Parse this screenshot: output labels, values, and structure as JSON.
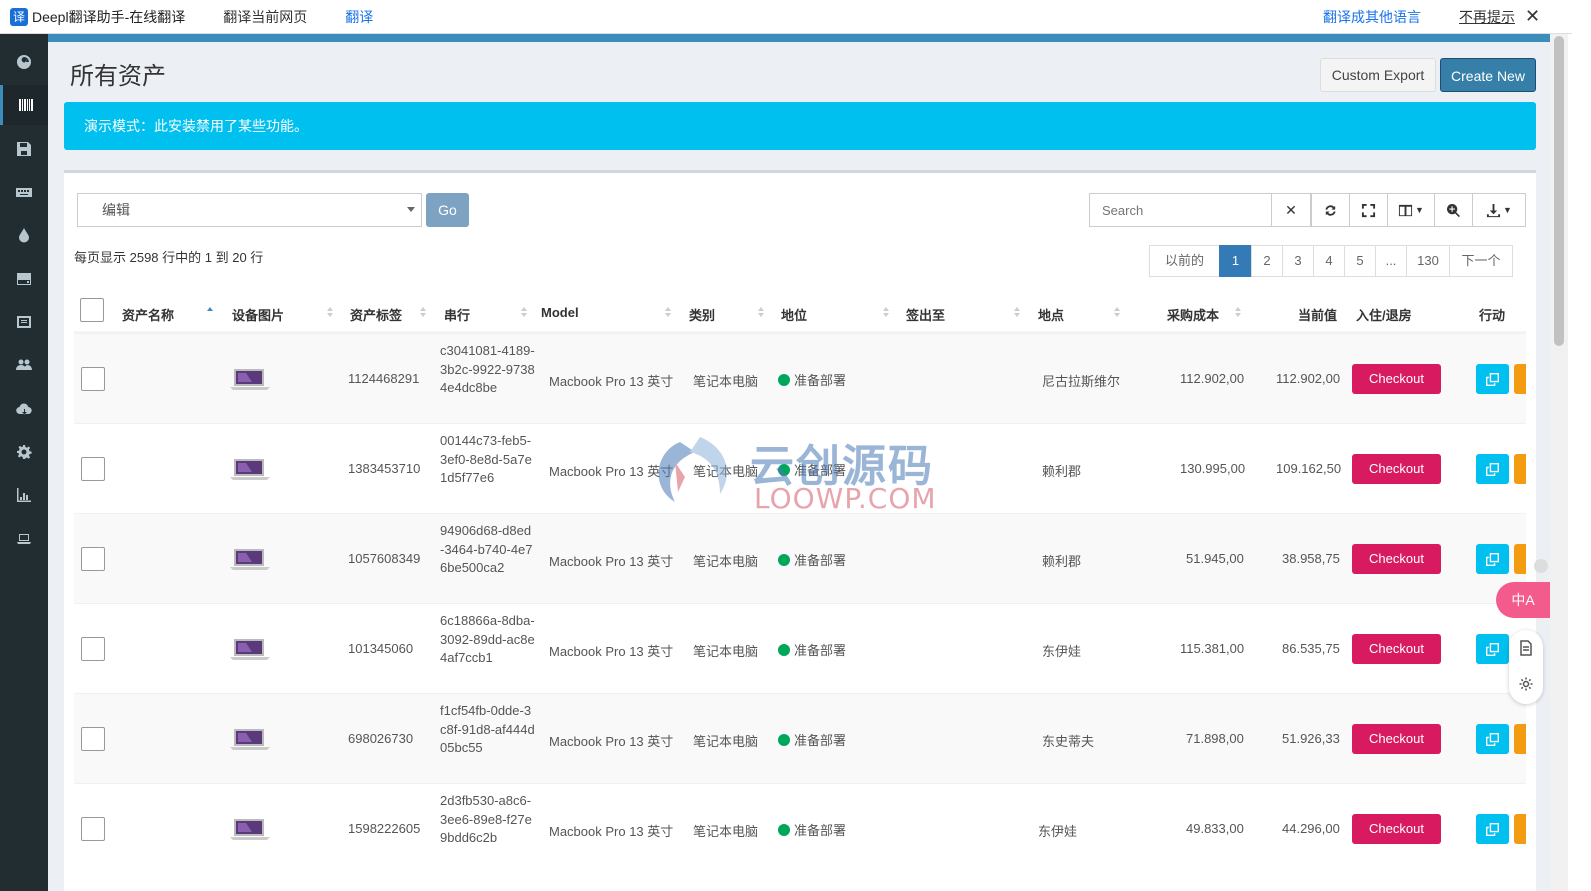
{
  "translate_bar": {
    "logo_char": "译",
    "title": "Deepl翻译助手-在线翻译",
    "translate_page": "翻译当前网页",
    "translate": "翻译",
    "other_lang": "翻译成其他语言",
    "dont_show": "不再提示",
    "close": "✕"
  },
  "page": {
    "title": "所有资产",
    "custom_export": "Custom Export",
    "create_new": "Create New",
    "demo_alert": "演示模式：此安装禁用了某些功能。"
  },
  "toolbar": {
    "bulk_action": "编辑",
    "go": "Go",
    "search_placeholder": "Search",
    "clear": "✕"
  },
  "pagination": {
    "info": "每页显示 2598 行中的 1 到 20 行",
    "prev": "以前的",
    "pages": [
      "1",
      "2",
      "3",
      "4",
      "5",
      "...",
      "130"
    ],
    "next": "下一个",
    "active_page": "1"
  },
  "table": {
    "headers": {
      "name": "资产名称",
      "image": "设备图片",
      "tag": "资产标签",
      "serial": "串行",
      "model": "Model",
      "category": "类别",
      "status": "地位",
      "checked_out_to": "签出至",
      "location": "地点",
      "purchase_cost": "采购成本",
      "current_value": "当前值",
      "checkin_out": "入住/退房",
      "actions": "行动"
    },
    "checkout_label": "Checkout",
    "rows": [
      {
        "tag": "1124468291",
        "serial": "c3041081-4189-3b2c-9922-97384e4dc8be",
        "model": "Macbook Pro 13 英寸",
        "category": "笔记本电脑",
        "status": "准备部署",
        "location": "尼古拉斯维尔",
        "cost": "112.902,00",
        "value": "112.902,00"
      },
      {
        "tag": "1383453710",
        "serial": "00144c73-feb5-3ef0-8e8d-5a7e1d5f77e6",
        "model": "Macbook Pro 13 英寸",
        "category": "笔记本电脑",
        "status": "准备部署",
        "location": "赖利郡",
        "cost": "130.995,00",
        "value": "109.162,50"
      },
      {
        "tag": "1057608349",
        "serial": "94906d68-d8ed-3464-b740-4e76be500ca2",
        "model": "Macbook Pro 13 英寸",
        "category": "笔记本电脑",
        "status": "准备部署",
        "location": "赖利郡",
        "cost": "51.945,00",
        "value": "38.958,75"
      },
      {
        "tag": "101345060",
        "serial": "6c18866a-8dba-3092-89dd-ac8e4af7ccb1",
        "model": "Macbook Pro 13 英寸",
        "category": "笔记本电脑",
        "status": "准备部署",
        "location": "东伊娃",
        "cost": "115.381,00",
        "value": "86.535,75"
      },
      {
        "tag": "698026730",
        "serial": "f1cf54fb-0dde-3c8f-91d8-af444d05bc55",
        "model": "Macbook Pro 13 英寸",
        "category": "笔记本电脑",
        "status": "准备部署",
        "location": "东史蒂夫",
        "cost": "71.898,00",
        "value": "51.926,33"
      },
      {
        "tag": "1598222605",
        "serial": "2d3fb530-a8c6-3ee6-89e8-f27e9bdd6c2b",
        "model": "Macbook Pro 13 英寸",
        "category": "笔记本电脑",
        "status": "准备部署",
        "location": "东伊娃",
        "cost": "49.833,00",
        "value": "44.296,00"
      }
    ]
  },
  "watermark": {
    "cn": "云创源码",
    "en": "LOOWP.COM"
  },
  "float_widget": {
    "label": "中A"
  },
  "colors": {
    "sidebar": "#222d32",
    "primary": "#3c8dbc",
    "info": "#00c0ef",
    "checkout": "#d81b60",
    "status_ready": "#00a65a",
    "edit": "#f39c12"
  },
  "icons": {
    "sidebar": [
      "dashboard-icon",
      "barcode-icon",
      "save-icon",
      "keyboard-icon",
      "tint-icon",
      "hdd-icon",
      "license-icon",
      "users-icon",
      "cloud-download-icon",
      "settings-icon",
      "reports-icon",
      "laptop-icon"
    ]
  }
}
